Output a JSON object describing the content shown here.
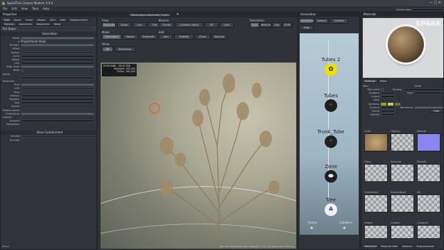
{
  "app": {
    "title": "SpeedTree Cinema Modeler 9.0.0"
  },
  "menu": [
    "File",
    "Edit",
    "View",
    "Tools",
    "Help"
  ],
  "properties": {
    "title": "Properties",
    "tabs": [
      "Gen",
      "Spine",
      "Pulse",
      "Shape",
      "Skin",
      "LOD",
      "Displacement",
      "Material",
      "Animation",
      "Segments",
      "Wind",
      "Props"
    ],
    "generation_header": "Generation",
    "proportional_steps": "Proportional steps",
    "pro_steps": "Pro Steps",
    "fields": [
      "Mode",
      "Number",
      "Offset",
      "Radius",
      "Limit",
      "Shape",
      "Link",
      "Align style",
      "Align"
    ],
    "spine_header": "Spine",
    "branches_header": "Branches",
    "branch_fields": [
      "First",
      "Last",
      "Step",
      "Interior",
      "Position",
      "Size"
    ],
    "forces": "Forces",
    "force_fields": [
      "Extend parent",
      "Child plane"
    ],
    "growth": "Growth",
    "growth_fields": [
      "Amount",
      "Resolution"
    ],
    "zone_containment": "Zone Containment",
    "zone_fields": [
      "Include",
      "Exclude"
    ],
    "bottom": "Reset"
  },
  "viewport": {
    "tab": "Ditchvagus macrocalle_3.spm",
    "toolbars": {
      "view": "View",
      "branch": "Branch",
      "resolution": "Resolution",
      "view_buttons": [
        "Generate",
        "Zoom",
        "Live",
        "Flat"
      ],
      "branch_buttons": [
        "Fronds",
        "Collision Object",
        "Fill",
        "Light"
      ],
      "resolution_buttons": [
        "High",
        "Medium",
        "Low",
        "Draft"
      ],
      "mode": "Mode",
      "mode_buttons": [
        "Generators",
        "Nodes",
        "Freehand"
      ],
      "edit": "Edit",
      "edit_buttons": [
        "Add",
        "Visibility",
        "Clone",
        "Bounds"
      ],
      "show": "Show",
      "show_buttons": [
        "Off",
        "Wireframe"
      ]
    },
    "stats": {
      "title": "POLYGONS - SELECTED",
      "selected": "Selected: 150,250",
      "total": "TOTAL: 150,250"
    },
    "status": "Lite: Lite PreviewTree Lite Computer 45 47 ms (draw time 15.62 ms)"
  },
  "generation_graph": {
    "title": "Generation",
    "buttons": [
      "Generators",
      "Actions",
      "Visibility",
      "Hide"
    ],
    "nodes": [
      {
        "label": "Tubes 2",
        "icon": "tube-leaf-icon"
      },
      {
        "label": "Tubes",
        "icon": "branch-icon"
      },
      {
        "label": "Trunk_Tube",
        "icon": "branch-icon"
      },
      {
        "label": "Zone",
        "icon": "zone-icon"
      },
      {
        "label": "Tree",
        "icon": "tree-icon"
      }
    ],
    "bottom_labels": [
      "Forces",
      "Colliders"
    ]
  },
  "materials": {
    "title": "Materials",
    "search_label": "Search help",
    "watermark": "SPARK",
    "tabs": [
      "Settings",
      "Maps"
    ],
    "settings": [
      "Main",
      "Two sided",
      "Ambient",
      "Cutout",
      "Color",
      "Variation",
      "Amount",
      "Fade",
      "Detail",
      "Opacity",
      "Sorting",
      "Pixel",
      "Scale",
      "Rendering"
    ],
    "swatches": [
      "Color",
      "Opacity",
      "Normal",
      "Gloss",
      "Specular",
      "Metallic",
      "Subsurface",
      "Subsurface2",
      "AO",
      "Height",
      "Custom",
      "Custom2"
    ],
    "bottom_tabs": [
      "Materials",
      "Material Sets",
      "Meshes",
      "Displacement"
    ],
    "buttons": [
      "Default",
      "Hide"
    ]
  },
  "accent": "#e85a20"
}
